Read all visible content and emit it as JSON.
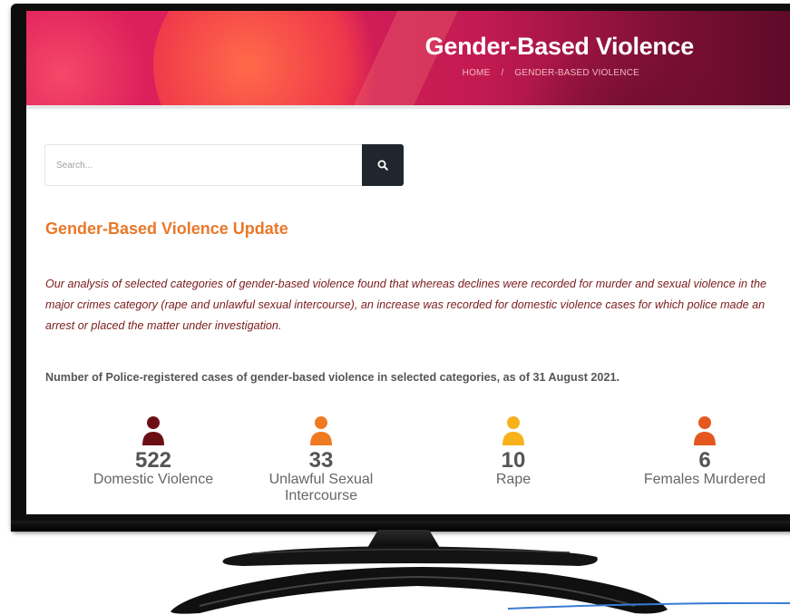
{
  "banner": {
    "title": "Gender-Based Violence",
    "breadcrumb": {
      "home": "HOME",
      "separator": "/",
      "current": "GENDER-BASED VIOLENCE"
    }
  },
  "search": {
    "placeholder": "Search...",
    "button_icon": "search-icon"
  },
  "section": {
    "title": "Gender-Based Violence Update"
  },
  "intro": "Our analysis of selected categories of gender-based violence found that whereas declines were recorded for murder and sexual violence in the major crimes category (rape and unlawful sexual intercourse), an increase was recorded for domestic violence cases for which police made an arrest or placed the matter under investigation.",
  "stats_caption": "Number of Police-registered cases of gender-based violence in selected categories, as of 31 August 2021.",
  "stats": [
    {
      "value": "522",
      "label": "Domestic Violence",
      "icon": "person-icon",
      "color": "#6b0f14"
    },
    {
      "value": "33",
      "label": "Unlawful Sexual Intercourse",
      "icon": "person-icon",
      "color": "#ef7a22"
    },
    {
      "value": "10",
      "label": "Rape",
      "icon": "person-icon",
      "color": "#f7b21b"
    },
    {
      "value": "6",
      "label": "Females Murdered",
      "icon": "person-icon",
      "color": "#e4571e"
    }
  ],
  "colors": {
    "accent": "#e8782a",
    "intro_text": "#7a1c1c",
    "banner": "#d91f5a",
    "search_button": "#1f262d"
  }
}
